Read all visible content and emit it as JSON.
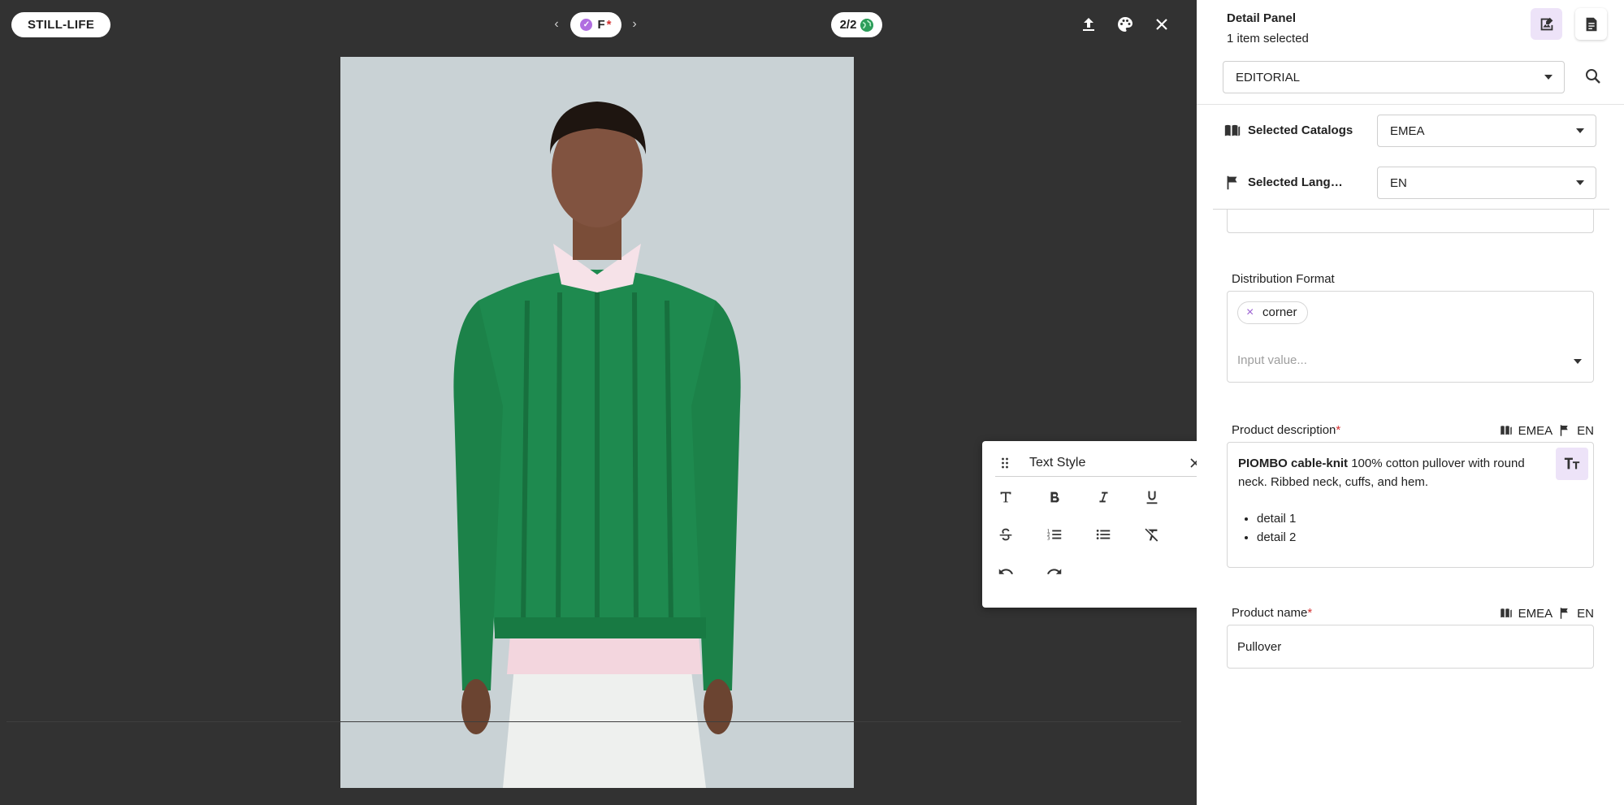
{
  "viewer": {
    "still_life_label": "STILL-LIFE",
    "prev_label": "‹",
    "next_label": "›",
    "favorite_label": "F",
    "favorite_required": "*",
    "counter_label": "2/2",
    "accent": "#b06ee0"
  },
  "photo": {
    "description_icon": "model-wearing-green-cable-knit-sweater-image"
  },
  "text_style": {
    "title": "Text Style",
    "tools": [
      "text-icon",
      "bold-icon",
      "italic-icon",
      "underline-icon",
      "strikethrough-icon",
      "numbered-list-icon",
      "bullet-list-icon",
      "clear-format-icon",
      "undo-icon",
      "redo-icon"
    ]
  },
  "panel": {
    "title": "Detail Panel",
    "subtitle": "1 item selected",
    "view_select": "EDITORIAL",
    "catalogs_label": "Selected Catalogs",
    "catalogs_value": "EMEA",
    "languages_label": "Selected Languages",
    "languages_value": "EN",
    "distribution": {
      "label": "Distribution Format",
      "tag": "corner",
      "placeholder": "Input value..."
    },
    "product_description": {
      "label": "Product description",
      "required": "*",
      "catalog": "EMEA",
      "lang": "EN",
      "bold_text": "PIOMBO cable-knit",
      "rest_text": " 100% cotton pullover with round neck. Ribbed neck, cuffs, and hem.",
      "bullets": [
        "detail 1",
        "detail 2"
      ]
    },
    "product_name": {
      "label": "Product name",
      "required": "*",
      "catalog": "EMEA",
      "lang": "EN",
      "value": "Pullover"
    }
  }
}
